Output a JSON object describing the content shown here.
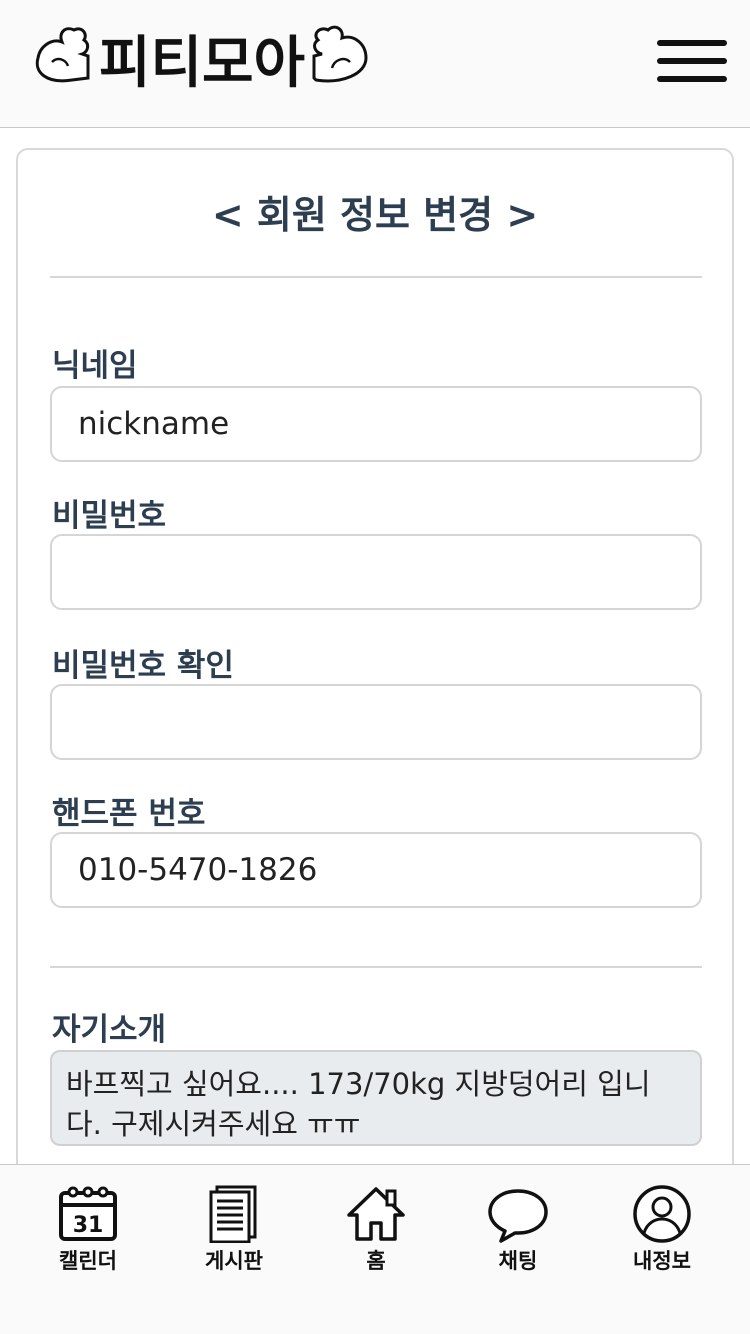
{
  "header": {
    "logo_text": "피티모아",
    "menu_icon": "hamburger-menu-icon"
  },
  "page": {
    "title": "< 회원 정보 변경 >"
  },
  "form": {
    "nickname": {
      "label": "닉네임",
      "value": "nickname"
    },
    "password": {
      "label": "비밀번호",
      "value": ""
    },
    "password_confirm": {
      "label": "비밀번호 확인",
      "value": ""
    },
    "phone": {
      "label": "핸드폰 번호",
      "value": "010-5470-1826"
    },
    "intro": {
      "label": "자기소개",
      "value": "바프찍고 싶어요.... 173/70kg 지방덩어리 입니다. 구제시켜주세요 ㅠㅠ"
    }
  },
  "bottom_nav": {
    "items": [
      {
        "label": "캘린더",
        "icon": "calendar-icon",
        "calendar_day": "31"
      },
      {
        "label": "게시판",
        "icon": "document-stack-icon"
      },
      {
        "label": "홈",
        "icon": "home-icon"
      },
      {
        "label": "채팅",
        "icon": "chat-bubble-icon"
      },
      {
        "label": "내정보",
        "icon": "user-profile-icon"
      }
    ]
  }
}
